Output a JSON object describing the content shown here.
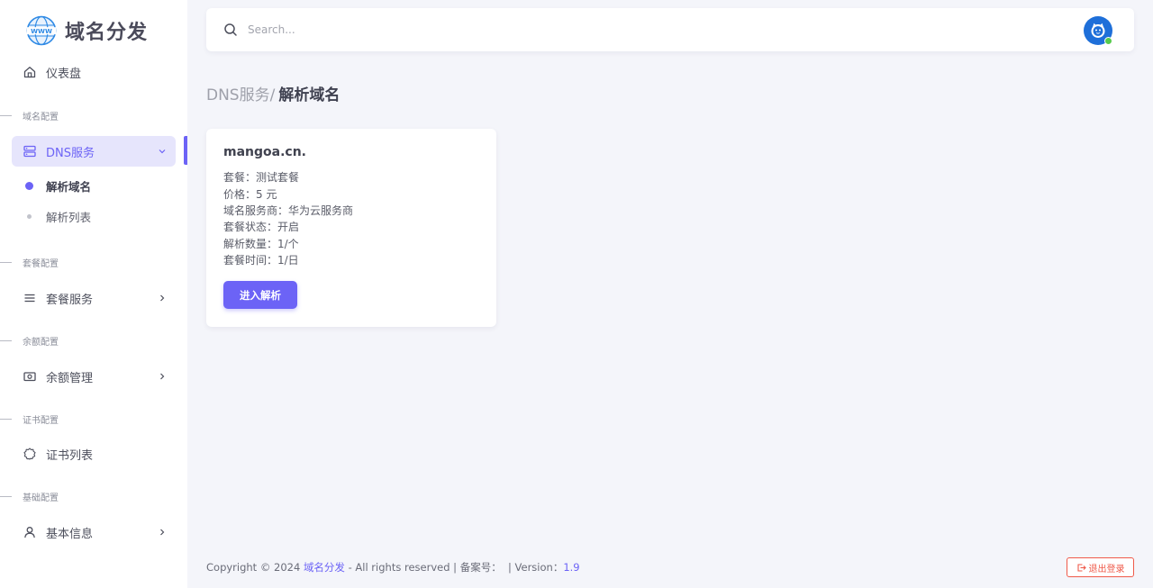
{
  "brand": {
    "name": "域名分发",
    "logo_icon": "www-globe-icon"
  },
  "sidebar": {
    "dashboard": {
      "label": "仪表盘",
      "icon": "home-icon"
    },
    "sections": [
      {
        "title": "域名配置"
      },
      {
        "title": "套餐配置"
      },
      {
        "title": "余额配置"
      },
      {
        "title": "证书配置"
      },
      {
        "title": "基础配置"
      }
    ],
    "dns": {
      "label": "DNS服务",
      "icon": "server-icon",
      "expanded": true,
      "children": [
        {
          "label": "解析域名",
          "current": true
        },
        {
          "label": "解析列表",
          "current": false
        }
      ]
    },
    "package": {
      "label": "套餐服务",
      "icon": "list-icon"
    },
    "balance": {
      "label": "余额管理",
      "icon": "cash-icon"
    },
    "cert": {
      "label": "证书列表",
      "icon": "badge-icon"
    },
    "profile": {
      "label": "基本信息",
      "icon": "user-icon"
    }
  },
  "search": {
    "placeholder": "Search...",
    "value": ""
  },
  "breadcrumb": {
    "parent": "DNS服务",
    "separator": "/",
    "current": "解析域名"
  },
  "card": {
    "title": "mangoa.cn.",
    "lines": [
      "套餐：测试套餐",
      "价格：5 元",
      "域名服务商：华为云服务商",
      "套餐状态：开启",
      "解析数量：1/个",
      "套餐时间：1/日"
    ],
    "button_label": "进入解析"
  },
  "footer": {
    "prefix": "Copyright © 2024 ",
    "brand_link": "域名分发",
    "rights": " - All rights reserved | 备案号：  | Version：",
    "version": "1.9"
  },
  "logout": {
    "label": "退出登录"
  },
  "colors": {
    "accent": "#6c63f6",
    "danger": "#ef5a4a",
    "online": "#56ca4c"
  }
}
